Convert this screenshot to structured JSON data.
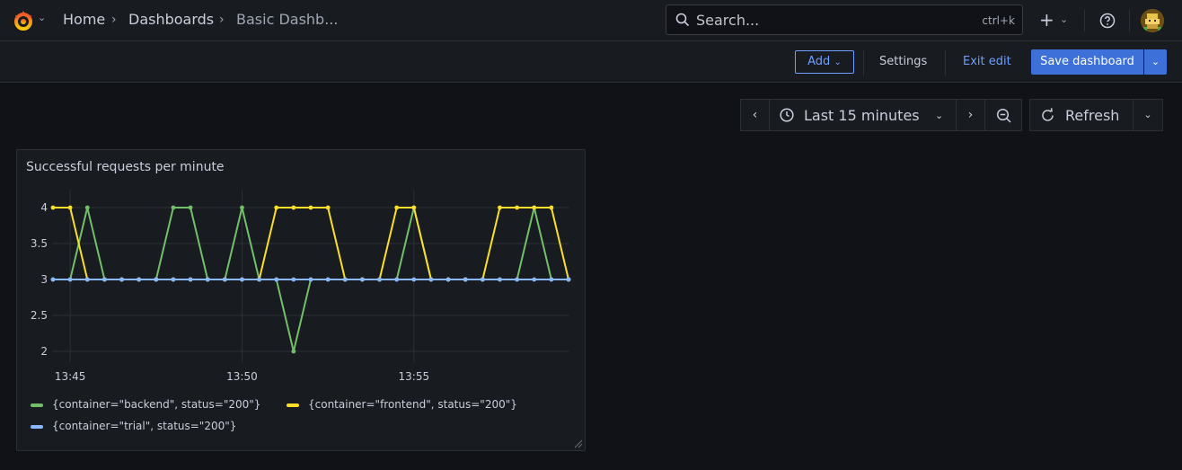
{
  "breadcrumb": {
    "home": "Home",
    "sep": "›",
    "dashboards": "Dashboards",
    "current": "Basic Dashb..."
  },
  "search": {
    "placeholder": "Search...",
    "shortcut": "ctrl+k"
  },
  "topbar": {
    "plus": "+",
    "caret": "⌄"
  },
  "edit_toolbar": {
    "add_label": "Add",
    "settings_label": "Settings",
    "exit_label": "Exit edit",
    "save_label": "Save dashboard"
  },
  "time_controls": {
    "prev": "‹",
    "next": "›",
    "range_label": "Last 15 minutes",
    "refresh_label": "Refresh"
  },
  "colors": {
    "accent": "#3d71d9",
    "link": "#6e9fff",
    "backend": "#73bf69",
    "frontend": "#fade2a",
    "trial": "#8ab8ff"
  },
  "panel": {
    "title": "Successful requests per minute",
    "chart_data": {
      "type": "line",
      "title": "Successful requests per minute",
      "x_tick_labels": [
        "13:45",
        "13:50",
        "13:55"
      ],
      "y_tick_labels": [
        "4",
        "3.5",
        "3",
        "2.5",
        "2"
      ],
      "ylim": [
        1.85,
        4.15
      ],
      "xlim": [
        0,
        30
      ],
      "x_tick_positions": [
        1,
        11,
        21
      ],
      "grid": true,
      "legend_position": "bottom",
      "series": [
        {
          "name": "{container=\"backend\", status=\"200\"}",
          "color": "#73bf69",
          "values": [
            3,
            3,
            4,
            3,
            3,
            3,
            3,
            4,
            4,
            3,
            3,
            4,
            3,
            3,
            2,
            3,
            3,
            3,
            3,
            3,
            3,
            4,
            3,
            3,
            3,
            3,
            3,
            3,
            4,
            3,
            3
          ]
        },
        {
          "name": "{container=\"frontend\", status=\"200\"}",
          "color": "#fade2a",
          "values": [
            4,
            4,
            3,
            3,
            3,
            3,
            3,
            3,
            3,
            3,
            3,
            3,
            3,
            4,
            4,
            4,
            4,
            3,
            3,
            3,
            4,
            4,
            3,
            3,
            3,
            3,
            4,
            4,
            4,
            4,
            3
          ]
        },
        {
          "name": "{container=\"trial\", status=\"200\"}",
          "color": "#8ab8ff",
          "values": [
            3,
            3,
            3,
            3,
            3,
            3,
            3,
            3,
            3,
            3,
            3,
            3,
            3,
            3,
            3,
            3,
            3,
            3,
            3,
            3,
            3,
            3,
            3,
            3,
            3,
            3,
            3,
            3,
            3,
            3,
            3
          ]
        }
      ]
    }
  }
}
